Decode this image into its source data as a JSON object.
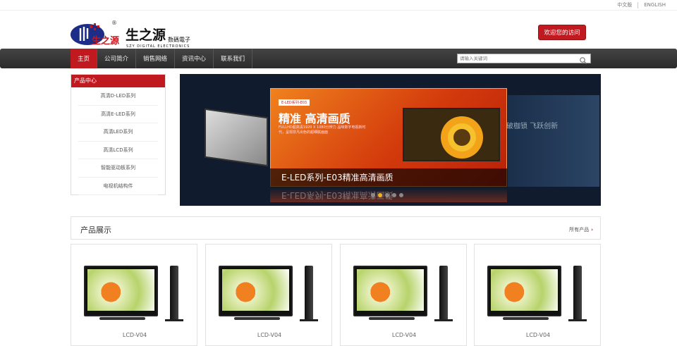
{
  "topbar": {
    "lang_cn": "中文版",
    "lang_en": "ENGLISH"
  },
  "header": {
    "brand_cn": "生之源",
    "brand_sub": "数碼電子",
    "brand_en": "SZY DIGITAL ELECTRONICS",
    "welcome_label": "欢迎您的访问"
  },
  "nav": {
    "items": [
      "主页",
      "公司简介",
      "销售网络",
      "资讯中心",
      "联系我们"
    ]
  },
  "search": {
    "placeholder": "请输入关键词"
  },
  "sidebar": {
    "title": "产品中心",
    "items": [
      "高清D-LED系列",
      "高清E-LED系列",
      "高清LED系列",
      "高清LCD系列",
      "智能驱动板系列",
      "电视机结构件"
    ]
  },
  "banner": {
    "tag": "E-LED系列-E03",
    "title": "精准 高清画质",
    "subtitle": "FULLHD超高清1920 X 1080分辨力 品味数字电视新时代，呈现非凡出色的超细腻画面",
    "caption": "E-LED系列-E03精准高清画质",
    "right_text": "破枷锁 飞跃创新"
  },
  "products": {
    "title": "产品展示",
    "more": "所有产品",
    "items": [
      "LCD-V04",
      "LCD-V04",
      "LCD-V04",
      "LCD-V04"
    ]
  },
  "colors": {
    "accent": "#c01920",
    "nav_bg": "#333333"
  }
}
